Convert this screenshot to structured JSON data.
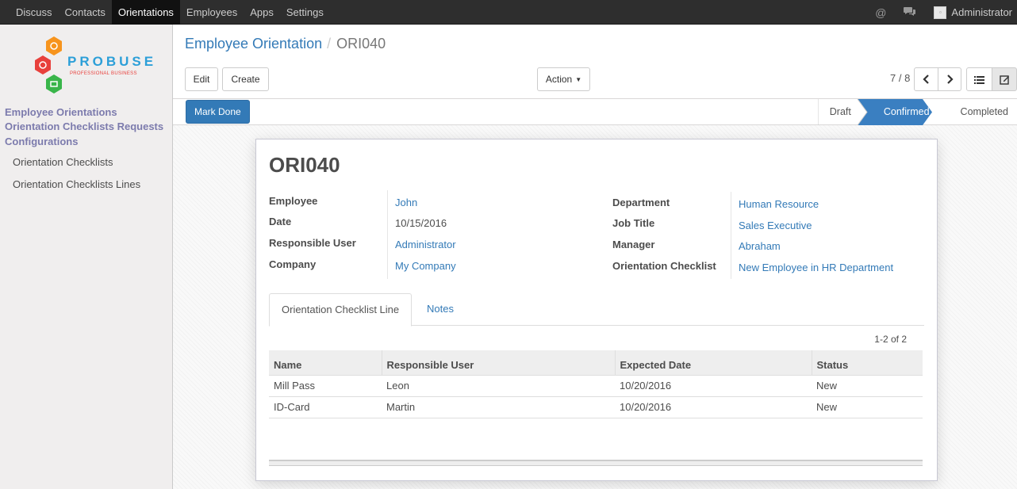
{
  "topnav": {
    "items": [
      {
        "label": "Discuss"
      },
      {
        "label": "Contacts"
      },
      {
        "label": "Orientations",
        "active": true
      },
      {
        "label": "Employees"
      },
      {
        "label": "Apps"
      },
      {
        "label": "Settings"
      }
    ],
    "user": "Administrator"
  },
  "sidebar": {
    "logo_text": "PROBUSE",
    "logo_tagline": "PROFESSIONAL BUSINESS",
    "sections": [
      {
        "label": "Employee Orientations"
      },
      {
        "label": "Orientation Checklists Requests"
      },
      {
        "label": "Configurations"
      }
    ],
    "items": [
      {
        "label": "Orientation Checklists"
      },
      {
        "label": "Orientation Checklists Lines"
      }
    ]
  },
  "breadcrumb": {
    "parent": "Employee Orientation",
    "separator": "/",
    "current": "ORI040"
  },
  "toolbar": {
    "edit": "Edit",
    "create": "Create",
    "action": "Action"
  },
  "pager": {
    "value": "7 / 8"
  },
  "statusbar": {
    "mark_done": "Mark Done",
    "stages": [
      {
        "label": "Draft"
      },
      {
        "label": "Confirmed",
        "active": true
      },
      {
        "label": "Completed"
      }
    ]
  },
  "record": {
    "name": "ORI040",
    "left_fields": [
      {
        "label": "Employee",
        "value": "John"
      },
      {
        "label": "Date",
        "value": "10/15/2016"
      },
      {
        "label": "Responsible User",
        "value": "Administrator"
      },
      {
        "label": "Company",
        "value": "My Company"
      }
    ],
    "right_fields": [
      {
        "label": "Department",
        "value": "Human Resource"
      },
      {
        "label": "Job Title",
        "value": "Sales Executive"
      },
      {
        "label": "Manager",
        "value": "Abraham"
      },
      {
        "label": "Orientation Checklist",
        "value": "New Employee in HR Department"
      }
    ]
  },
  "tabs": [
    {
      "label": "Orientation Checklist Line",
      "active": true
    },
    {
      "label": "Notes"
    }
  ],
  "lines": {
    "count": "1-2 of 2",
    "columns": [
      "Name",
      "Responsible User",
      "Expected Date",
      "Status"
    ],
    "rows": [
      [
        "Mill Pass",
        "Leon",
        "10/20/2016",
        "New"
      ],
      [
        "ID-Card",
        "Martin",
        "10/20/2016",
        "New"
      ]
    ]
  },
  "colors": {
    "accent": "#337ab7",
    "menu_heading": "#7c7bad",
    "navbar": "#2e2e2e"
  }
}
